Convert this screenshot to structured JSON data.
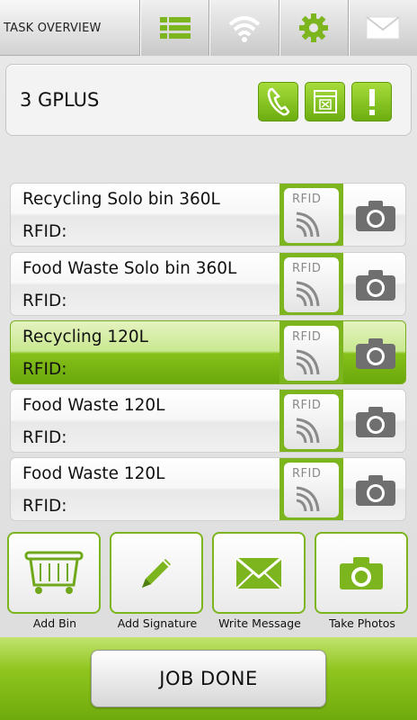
{
  "topbar": {
    "title": "TASK OVERVIEW",
    "buttons": [
      {
        "icon": "list-icon"
      },
      {
        "icon": "wifi-icon"
      },
      {
        "icon": "gear-icon"
      },
      {
        "icon": "mail-icon"
      }
    ]
  },
  "header": {
    "name": "3 GPLUS",
    "buttons": [
      {
        "icon": "phone-icon"
      },
      {
        "icon": "calendar-icon"
      },
      {
        "icon": "alert-icon"
      }
    ]
  },
  "bins": [
    {
      "name": "Recycling Solo bin 360L",
      "rfid_label": "RFID:",
      "selected": false
    },
    {
      "name": "Food Waste Solo bin 360L",
      "rfid_label": "RFID:",
      "selected": false
    },
    {
      "name": "Recycling 120L",
      "rfid_label": "RFID:",
      "selected": true
    },
    {
      "name": "Food Waste 120L",
      "rfid_label": "RFID:",
      "selected": false
    },
    {
      "name": "Food Waste 120L",
      "rfid_label": "RFID:",
      "selected": false
    }
  ],
  "rfid_button_text": "RFID",
  "actions": [
    {
      "label": "Add Bin",
      "icon": "bin-icon"
    },
    {
      "label": "Add Signature",
      "icon": "pencil-icon"
    },
    {
      "label": "Write Message",
      "icon": "envelope-icon"
    },
    {
      "label": "Take Photos",
      "icon": "camera-icon"
    }
  ],
  "job_done_label": "JOB DONE",
  "colors": {
    "accent_green": "#7db51f",
    "selected_row": "#86c01a"
  }
}
